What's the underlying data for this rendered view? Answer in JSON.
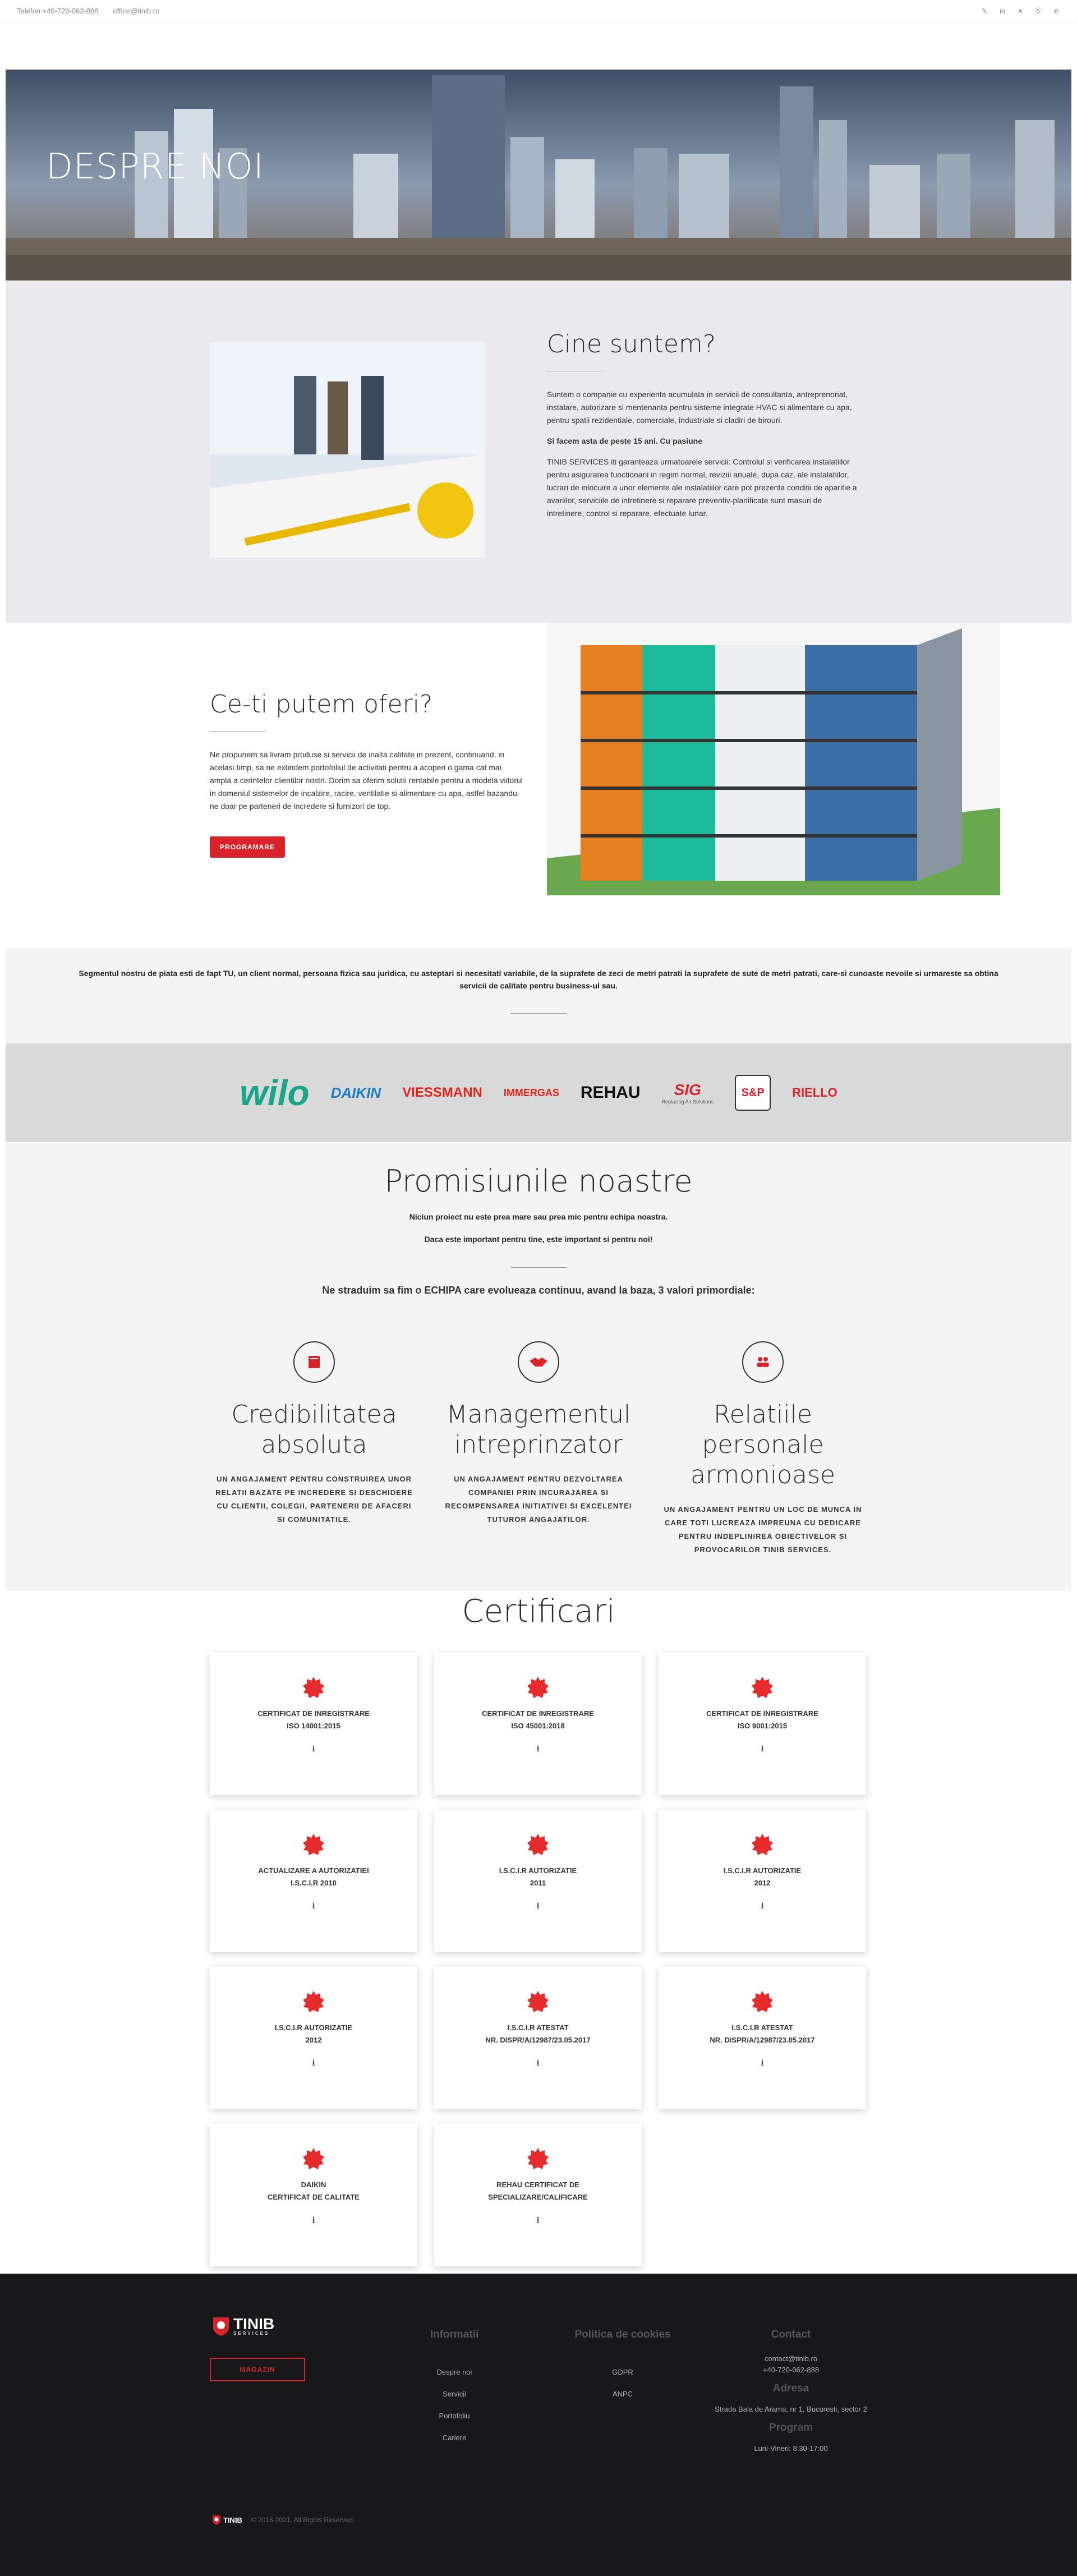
{
  "topbar": {
    "phone": "Telefon:+40-720-062-888",
    "email": "office@tinib.ro",
    "socials": [
      "twitter-icon",
      "linkedin-icon",
      "xing-icon",
      "skype-icon",
      "pinterest-icon"
    ]
  },
  "hero": {
    "title": "DESPRE NOI"
  },
  "who": {
    "title": "Cine suntem?",
    "p1": "Suntem o companie cu experienta acumulata in servicii de consultanta, antreprenoriat, instalare, autorizare si mentenanta pentru sisteme integrate HVAC si alimentare cu apa, pentru spatii rezidentiale, comerciale, industriale si cladiri de birouri.",
    "p2": "Si facem asta de peste 15 ani. Cu pasiune",
    "p3": "TINIB SERVICES iti garanteaza urmatoarele servicii: Controlul si verificarea instalatiilor pentru asigurarea functionarii in regim normal, reviziii anuale, dupa caz, ale instalatiilor, lucrari de inlocuire a unor elemente ale instalatiilor care pot prezenta conditii de aparitie a avariilor, serviciile de intretinere si reparare preventiv-planificate sunt masuri de intretinere, control si reparare, efectuate lunar."
  },
  "offer": {
    "title": "Ce-ti putem oferi?",
    "p1": "Ne propunem sa livram produse si servicii de inalta calitate in prezent, continuand, in acelasi timp, sa ne extindem portofoliul de activitati pentru a acoperi o gama cat mai ampla a cerintelor clientilor nostri. Dorim sa oferim solutii rentabile pentru a modela viitorul in domeniul sistemelor de incalzire, racire, ventilatie si alimentare cu apa, astfel bazandu-ne doar pe parteneri de incredere si furnizori de top.",
    "button": "PROGRAMARE"
  },
  "segment": {
    "text": "Segmentul nostru de piata esti de fapt TU, un client normal,  persoana fizica sau juridica, cu asteptari si necesitati variabile, de la suprafete de zeci de metri patrati la suprafete de sute de metri patrati, care-si cunoaste nevoile si urmareste sa obtina servicii de calitate pentru business-ul sau."
  },
  "partners": [
    "wilo",
    "DAIKIN",
    "VIESSMANN",
    "IMMERGAS",
    "REHAU",
    "SIG",
    "Replacing Air Solutions",
    "S&P",
    "RIELLO"
  ],
  "promises": {
    "title": "Promisiunile noastre",
    "sub1": "Niciun proiect nu este prea mare sau prea mic pentru echipa noastra.",
    "sub2": "Daca este important pentru tine, este important si pentru noi!",
    "lead": "Ne straduim sa fim o ECHIPA care evolueaza continuu, avand la baza, 3 valori primordiale:",
    "values": [
      {
        "icon": "book-icon",
        "title": "Credibilitatea absoluta",
        "text": "UN ANGAJAMENT PENTRU CONSTRUIREA UNOR RELATII BAZATE PE INCREDERE SI DESCHIDERE CU CLIENTII, COLEGII, PARTENERII DE AFACERI SI COMUNITATILE."
      },
      {
        "icon": "handshake-icon",
        "title": "Managementul intreprinzator",
        "text": "UN ANGAJAMENT PENTRU DEZVOLTAREA COMPANIEI PRIN INCURAJAREA SI RECOMPENSAREA INITIATIVEI SI EXCELENTEI TUTUROR ANGAJATILOR."
      },
      {
        "icon": "people-icon",
        "title": "Relatiile personale armonioase",
        "text": "UN ANGAJAMENT PENTRU UN LOC DE MUNCA IN CARE TOTI LUCREAZA IMPREUNA CU DEDICARE PENTRU INDEPLINIREA OBIECTIVELOR SI PROVOCARILOR TINIB SERVICES."
      }
    ]
  },
  "certs": {
    "title": "Certificari",
    "items": [
      "CERTIFICAT DE INREGISTRARE\nISO 14001:2015",
      "CERTIFICAT DE INREGISTRARE\nISO 45001:2018",
      "CERTIFICAT DE INREGISTRARE\nISO 9001:2015",
      "ACTUALIZARE A AUTORIZATIEI\nI.S.C.I.R 2010",
      "I.S.C.I.R AUTORIZATIE\n2011",
      "I.S.C.I.R AUTORIZATIE\n2012",
      "I.S.C.I.R AUTORIZATIE\n2012",
      "I.S.C.I.R ATESTAT\nNR. DISPR/A/12987/23.05.2017",
      "I.S.C.I.R ATESTAT\nNR. DISPR/A/12987/23.05.2017",
      "DAIKIN\nCERTIFICAT DE CALITATE",
      "REHAU CERTIFICAT DE\nSPECIALIZARE/CALIFICARE"
    ]
  },
  "footer": {
    "brand": "TINIB",
    "brand_sub": "SERVICES",
    "shop": "MAGAZIN",
    "col1": {
      "title": "Informatii",
      "links": [
        "Despre noi",
        "Servicii",
        "Portofoliu",
        "Cariere"
      ]
    },
    "col2": {
      "title": "Politica de cookies",
      "links": [
        "GDPR",
        "ANPC"
      ]
    },
    "contact": {
      "title": "Contact",
      "email": "contact@tinib.ro",
      "phone": "+40-720-062-888",
      "addr_title": "Adresa",
      "addr": "Strada Bala de Arama, nr 1, Bucuresti, sector 2",
      "prog_title": "Program",
      "prog": "Luni-Vineri: 8:30-17:00"
    },
    "copyright": "© 2016-2021. All Rights Reserved.",
    "accent": "#d8232a"
  }
}
